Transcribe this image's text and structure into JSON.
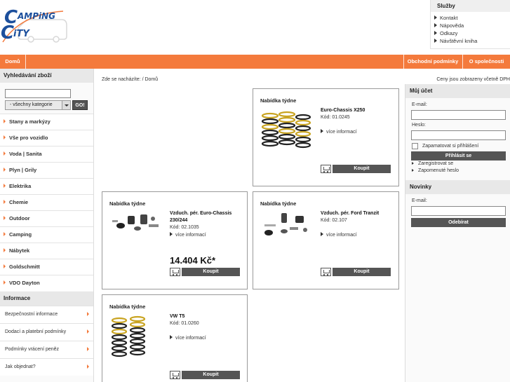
{
  "brand": {
    "logo_text_top": "AMPiNG",
    "logo_text_bottom": "iTY",
    "logo_c1": "C",
    "logo_c2": "C",
    "primary_color": "#1c4f9c",
    "accent_color": "#f47a3c"
  },
  "services": {
    "title": "Služby",
    "items": [
      "Kontakt",
      "Nápověda",
      "Odkazy",
      "Návštěvní kniha"
    ]
  },
  "topnav": {
    "home": "Domů",
    "terms": "Obchodní podmínky",
    "about": "O společnosti"
  },
  "search": {
    "title": "Vyhledávání zboží",
    "category_value": "- všechny kategorie",
    "go_label": "GO!"
  },
  "categories": [
    "Stany a markýzy",
    "Vše pro vozidlo",
    "Voda | Sanita",
    "Plyn | Grily",
    "Elektrika",
    "Chemie",
    "Outdoor",
    "Camping",
    "Nábytek",
    "Goldschmitt",
    "VDO Dayton"
  ],
  "info": {
    "title": "Informace",
    "items": [
      "Bezpečnostní informace",
      "Dodací a platební podmínky",
      "Podmínky vrácení peněz",
      "Jak objednat?"
    ]
  },
  "breadcrumb": "Zde se nacházíte: / Domů",
  "prices_note": "Ceny jsou zobrazeny včetně DPH",
  "offers": [
    {
      "head": "Nabídka týdne",
      "name": "Euro-Chassis X250",
      "code": "Kód: 01.0245",
      "more": "více informací",
      "buy": "Koupit",
      "price": ""
    },
    {
      "head": "Nabídka týdne",
      "name": "Vzduch. pér. Euro-Chassis 230/244",
      "code": "Kód: 02.1035",
      "more": "více informací",
      "buy": "Koupit",
      "price": "14.404 Kč*"
    },
    {
      "head": "Nabídka týdne",
      "name": "Vzduch. pér. Ford Tranzit",
      "code": "Kód: 02.107",
      "more": "více informací",
      "buy": "Koupit",
      "price": ""
    },
    {
      "head": "Nabídka týdne",
      "name": "VW T5",
      "code": "Kód: 01.0260",
      "more": "více informací",
      "buy": "Koupit",
      "price": ""
    }
  ],
  "account": {
    "title": "Můj účet",
    "email_label": "E-mail:",
    "password_label": "Heslo:",
    "remember_label": "Zapamatovat si přihlášení",
    "login_label": "Přihlásit se",
    "register_link": "Zaregistrovat se",
    "forgot_link": "Zapomenuté heslo"
  },
  "newsletter": {
    "title": "Novinky",
    "email_label": "E-mail:",
    "subscribe_label": "Odebírat"
  }
}
